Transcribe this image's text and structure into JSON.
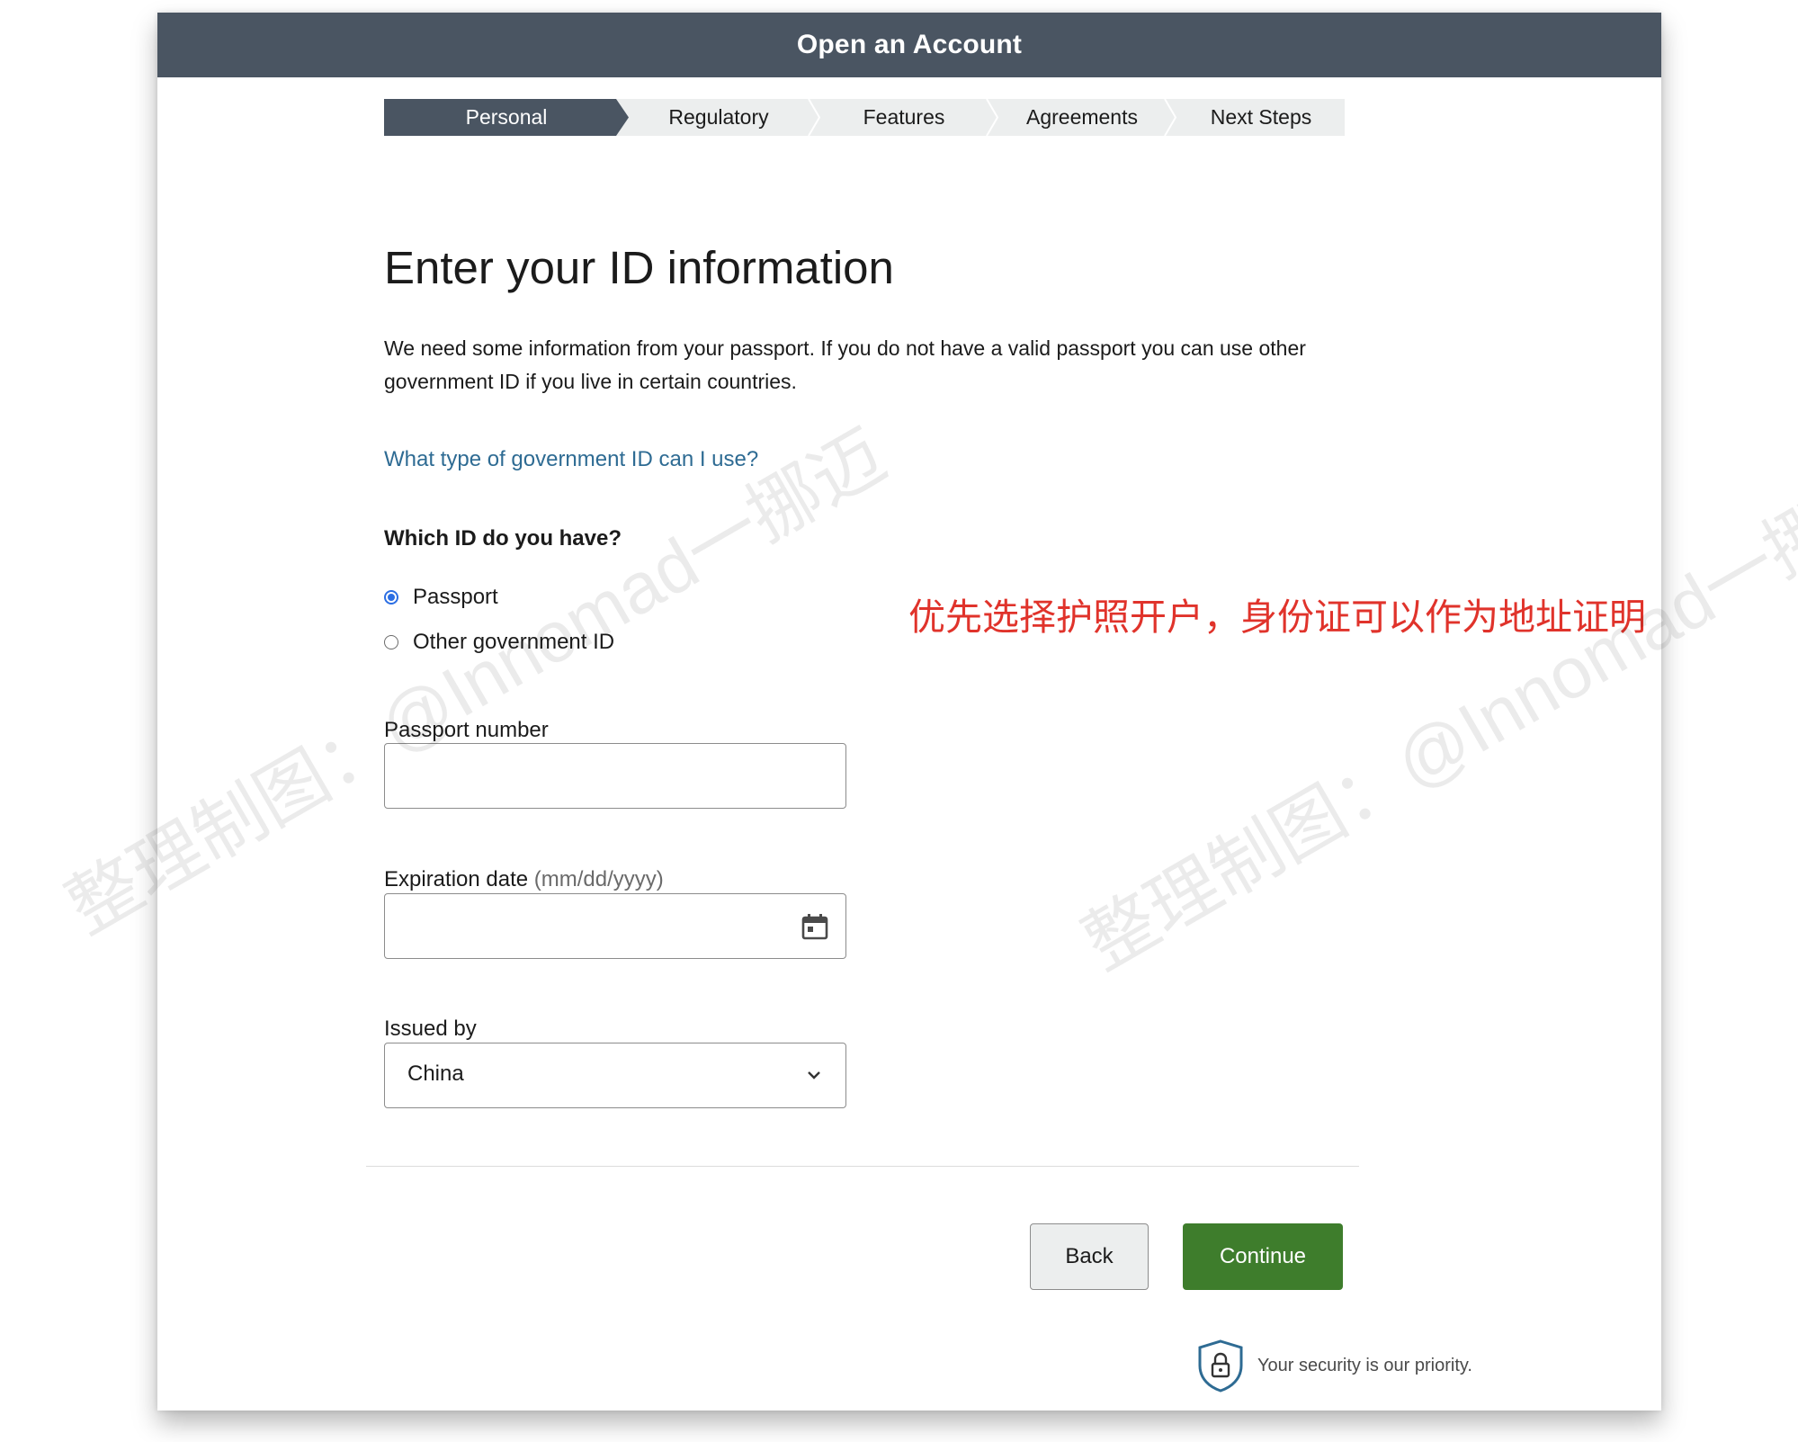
{
  "header": {
    "title": "Open an Account"
  },
  "steps": [
    {
      "label": "Personal",
      "active": true
    },
    {
      "label": "Regulatory",
      "active": false
    },
    {
      "label": "Features",
      "active": false
    },
    {
      "label": "Agreements",
      "active": false
    },
    {
      "label": "Next Steps",
      "active": false
    }
  ],
  "main": {
    "title": "Enter your ID information",
    "intro": "We need some information from your passport. If you do not have a valid passport you can use other government ID if you live in certain countries.",
    "help_link": "What type of government ID can I use?",
    "id_question": "Which ID do you have?",
    "id_options": [
      {
        "label": "Passport",
        "checked": true
      },
      {
        "label": "Other government ID",
        "checked": false
      }
    ],
    "annotation": "优先选择护照开户，身份证可以作为地址证明",
    "passport_number": {
      "label": "Passport number",
      "value": ""
    },
    "expiration_date": {
      "label": "Expiration date",
      "hint": "(mm/dd/yyyy)",
      "value": "",
      "icon": "calendar-icon"
    },
    "issued_by": {
      "label": "Issued by",
      "selected": "China",
      "icon": "chevron-down-icon"
    }
  },
  "footer": {
    "back_label": "Back",
    "continue_label": "Continue",
    "security_text": "Your security is our priority.",
    "security_icon": "shield-lock-icon"
  },
  "watermark": {
    "text": "整理制图：@Innomad一挪迈"
  },
  "colors": {
    "header_bg": "#4a5562",
    "step_active_bg": "#4a5562",
    "link": "#2e6b93",
    "continue_bg": "#3e7d2c",
    "annotation": "#e0332b",
    "radio_checked": "#2b6ee3"
  }
}
